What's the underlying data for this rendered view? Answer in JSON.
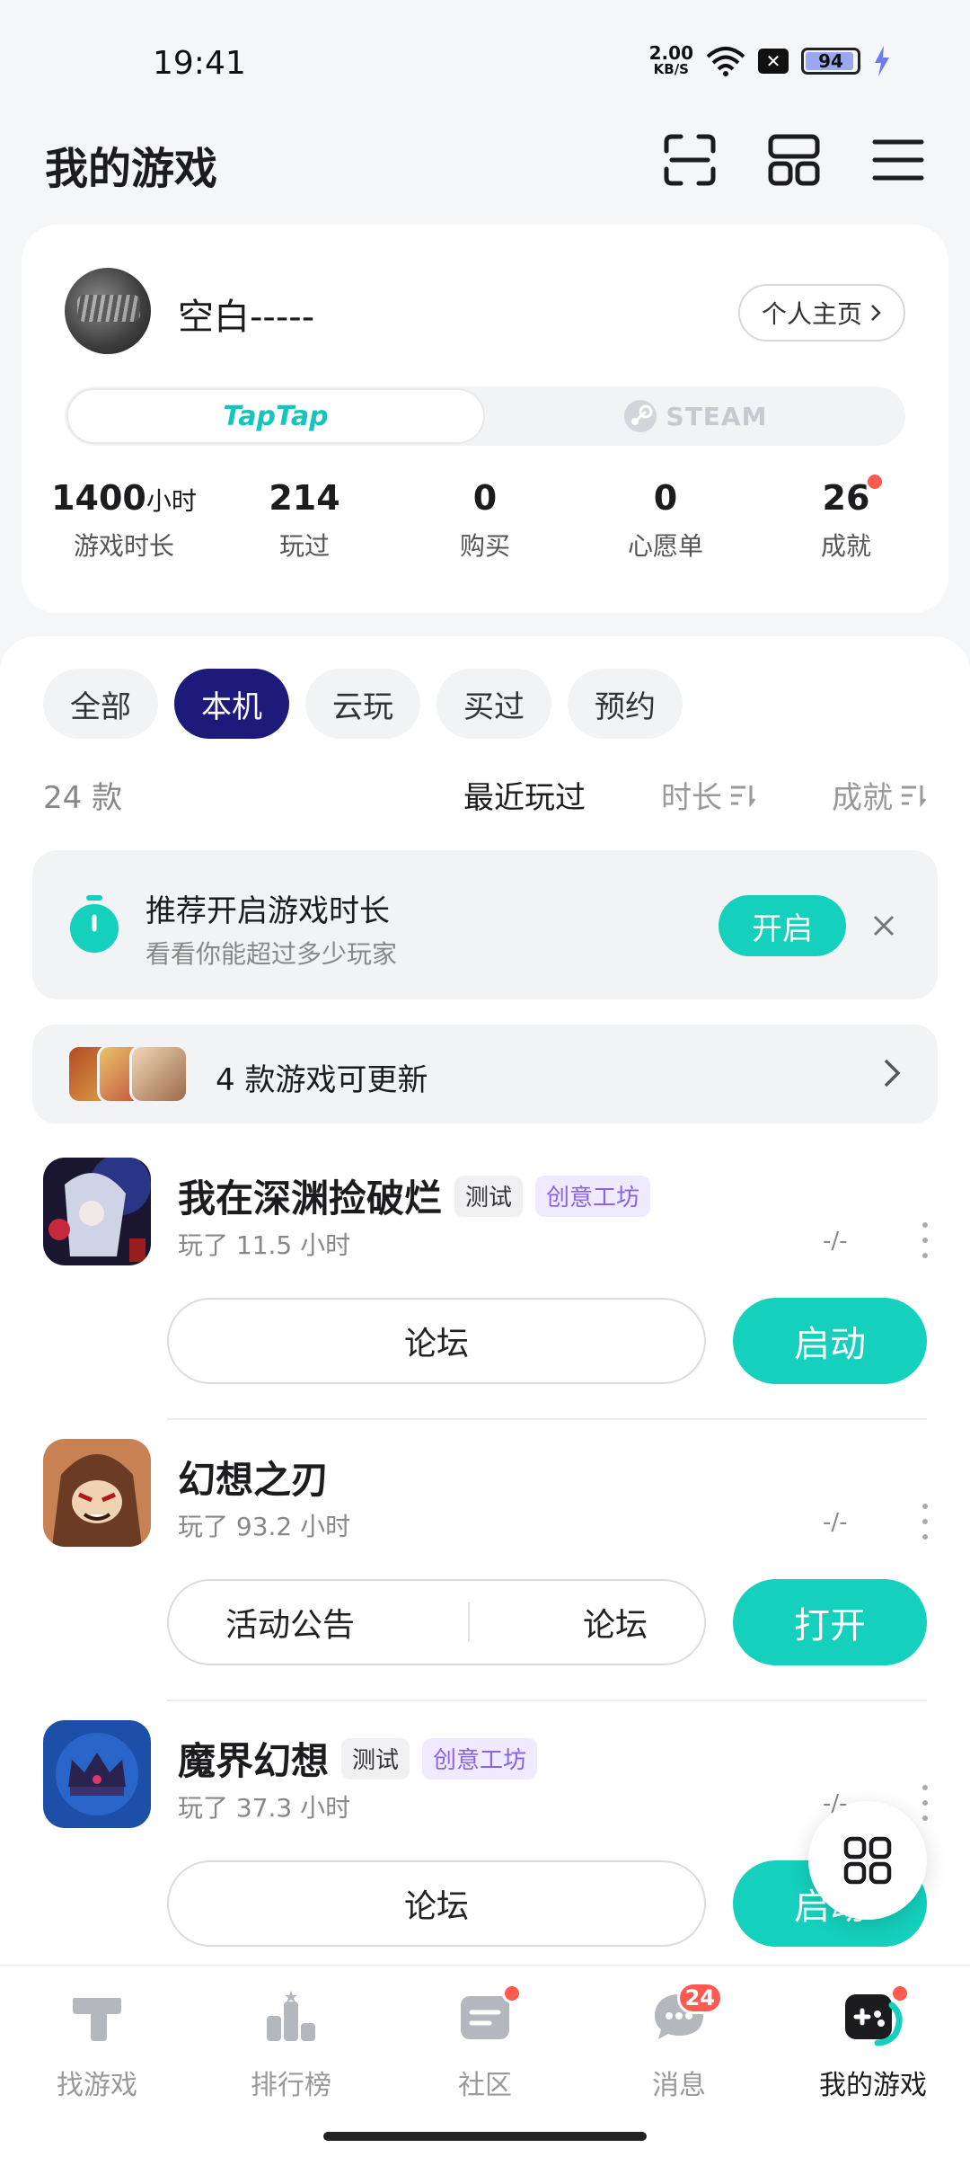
{
  "status_bar": {
    "time": "19:41",
    "net_speed_value": "2.00",
    "net_speed_unit": "KB/S",
    "battery": "94"
  },
  "header": {
    "title": "我的游戏"
  },
  "profile": {
    "username": "空白-----",
    "homepage_label": "个人主页",
    "platforms": {
      "active": "TapTap",
      "inactive": "STEAM"
    },
    "stats": [
      {
        "value": "1400",
        "unit": "小时",
        "label": "游戏时长"
      },
      {
        "value": "214",
        "unit": "",
        "label": "玩过"
      },
      {
        "value": "0",
        "unit": "",
        "label": "购买"
      },
      {
        "value": "0",
        "unit": "",
        "label": "心愿单"
      },
      {
        "value": "26",
        "unit": "",
        "label": "成就"
      }
    ]
  },
  "filters": [
    "全部",
    "本机",
    "云玩",
    "买过",
    "预约"
  ],
  "active_filter": "本机",
  "sort": {
    "count": "24 款",
    "options": [
      "最近玩过",
      "时长",
      "成就"
    ],
    "active": "最近玩过"
  },
  "recommend": {
    "title": "推荐开启游戏时长",
    "subtitle": "看看你能超过多少玩家",
    "button": "开启"
  },
  "update_banner": {
    "text": "4 款游戏可更新"
  },
  "games": [
    {
      "name": "我在深渊捡破烂",
      "tags": [
        "测试",
        "创意工坊"
      ],
      "playtime": "玩了 11.5 小时",
      "score": "-/-",
      "secondary": [
        "论坛"
      ],
      "primary": "启动"
    },
    {
      "name": "幻想之刃",
      "tags": [],
      "playtime": "玩了 93.2 小时",
      "score": "-/-",
      "secondary": [
        "活动公告",
        "论坛"
      ],
      "primary": "打开"
    },
    {
      "name": "魔界幻想",
      "tags": [
        "测试",
        "创意工坊"
      ],
      "playtime": "玩了 37.3 小时",
      "score": "-/-",
      "secondary": [
        "论坛"
      ],
      "primary": "启动"
    }
  ],
  "bottom_nav": [
    {
      "label": "找游戏",
      "icon": "find-games-icon"
    },
    {
      "label": "排行榜",
      "icon": "ranking-icon"
    },
    {
      "label": "社区",
      "icon": "community-icon"
    },
    {
      "label": "消息",
      "icon": "messages-icon",
      "badge": "24"
    },
    {
      "label": "我的游戏",
      "icon": "my-games-icon"
    }
  ],
  "colors": {
    "accent": "#15d0bd",
    "active_chip": "#1e1a7a",
    "badge": "#ff5a52",
    "workshop_tag": "#8a63e6"
  }
}
